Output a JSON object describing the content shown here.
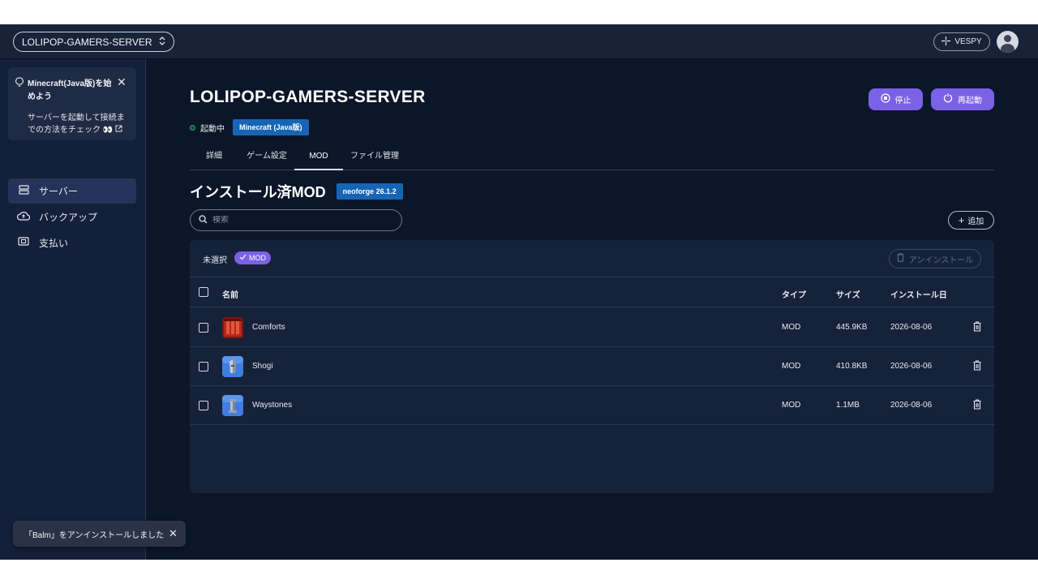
{
  "header": {
    "server_name": "LOLIPOP-GAMERS-SERVER",
    "vespy_label": "VESPY"
  },
  "sidebar": {
    "tip": {
      "title": "Minecraft(Java版)を始めよう",
      "body": "サーバーを起動して接続までの方法をチェック",
      "emoji": "👀"
    },
    "items": [
      {
        "label": "サーバー",
        "icon": "server-icon",
        "active": true
      },
      {
        "label": "バックアップ",
        "icon": "cloud-backup-icon",
        "active": false
      },
      {
        "label": "支払い",
        "icon": "payment-icon",
        "active": false
      }
    ]
  },
  "main": {
    "title": "LOLIPOP-GAMERS-SERVER",
    "status": "起動中",
    "edition_badge": "Minecraft (Java版)",
    "stop_label": "停止",
    "restart_label": "再起動",
    "tabs": [
      {
        "label": "詳細",
        "active": false
      },
      {
        "label": "ゲーム設定",
        "active": false
      },
      {
        "label": "MOD",
        "active": true
      },
      {
        "label": "ファイル管理",
        "active": false
      }
    ],
    "section_title": "インストール済MOD",
    "loader_badge": "neoforge 26.1.2",
    "search_placeholder": "検索",
    "add_label": "追加",
    "selection": {
      "text": "未選択",
      "chip": "MOD"
    },
    "uninstall_label": "アンインストール",
    "columns": {
      "name": "名前",
      "type": "タイプ",
      "size": "サイズ",
      "installed": "インストール日"
    },
    "rows": [
      {
        "name": "Comforts",
        "type": "MOD",
        "size": "445.9KB",
        "installed": "2026-08-06"
      },
      {
        "name": "Shogi",
        "type": "MOD",
        "size": "410.8KB",
        "installed": "2026-08-06"
      },
      {
        "name": "Waystones",
        "type": "MOD",
        "size": "1.1MB",
        "installed": "2026-08-06"
      }
    ]
  },
  "toast": {
    "message": "「Balm」をアンインストールしました"
  },
  "colors": {
    "accent": "#7b61e6",
    "badge_blue": "#1665b5",
    "background": "#0b1628",
    "status_green": "#2fa36b"
  }
}
